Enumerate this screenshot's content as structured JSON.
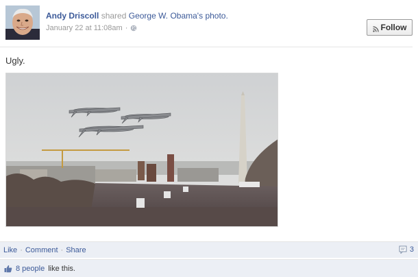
{
  "post": {
    "author": "Andy Driscoll",
    "shared_text": "shared",
    "source_page": "George W. Obama",
    "source_suffix": "'s",
    "object_label": "photo.",
    "timestamp": "January 22 at 11:08am",
    "separator": "·",
    "privacy_icon": "globe-icon",
    "status_text": "Ugly."
  },
  "follow_button": {
    "label": "Follow",
    "icon": "rss-icon"
  },
  "actions": {
    "like": "Like",
    "comment": "Comment",
    "share": "Share",
    "separator": "·",
    "comment_count": "3",
    "comment_icon": "comment-icon"
  },
  "likes": {
    "link_text": "8 people",
    "suffix_text": "like this.",
    "icon": "thumbs-up-icon"
  },
  "colors": {
    "link": "#3b5998",
    "muted": "#999999",
    "footer_bg": "#eceff5"
  }
}
